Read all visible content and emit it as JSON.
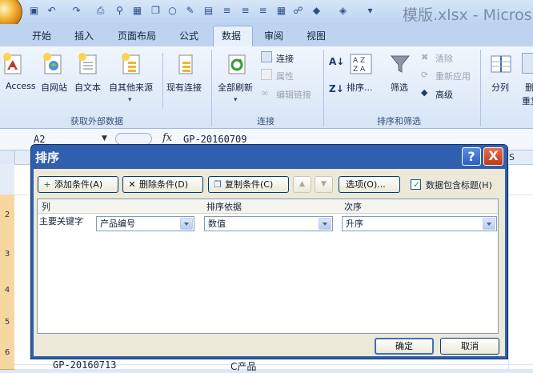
{
  "window": {
    "title": "模版.xlsx - Micros"
  },
  "ribbon_tabs": [
    "开始",
    "插入",
    "页面布局",
    "公式",
    "数据",
    "审阅",
    "视图"
  ],
  "ribbon": {
    "groups": {
      "external": {
        "label": "获取外部数据",
        "items": [
          "Access",
          "自网站",
          "自文本",
          "自其他来源",
          "现有连接"
        ]
      },
      "connections": {
        "label": "连接",
        "refresh": "全部刷新",
        "connect": "连接",
        "properties": "属性",
        "edit_links": "编辑链接"
      },
      "sort_filter": {
        "label": "排序和筛选",
        "sort": "排序...",
        "filter": "筛选",
        "clear": "清除",
        "reapply": "重新应用",
        "advanced": "高级"
      },
      "data_tools": {
        "split": "分列"
      }
    },
    "extra_labels": {
      "right_col_top": "删",
      "right_col_bottom": "重复"
    }
  },
  "formula_bar": {
    "name_box": "A2",
    "fx": "fx",
    "content": "GP-20160709"
  },
  "sheet": {
    "bottom_cell_a": "GP-20160713",
    "bottom_cell_b": "C产品",
    "row_numbers": [
      "2",
      "3",
      "4",
      "5",
      "6"
    ],
    "header_tail": "S"
  },
  "dialog": {
    "title": "排序",
    "help_label": "?",
    "close_label": "X",
    "toolbar": {
      "add": "添加条件(A)",
      "delete": "删除条件(D)",
      "copy": "复制条件(C)",
      "up": "▲",
      "down": "▼",
      "options": "选项(O)...",
      "has_header_label": "数据包含标题(H)",
      "has_header_checked": true
    },
    "columns": [
      "列",
      "排序依据",
      "次序"
    ],
    "rows": [
      {
        "label": "主要关键字",
        "column": "产品编号",
        "sort_on": "数值",
        "order": "升序"
      }
    ],
    "buttons": {
      "ok": "确定",
      "cancel": "取消"
    }
  }
}
